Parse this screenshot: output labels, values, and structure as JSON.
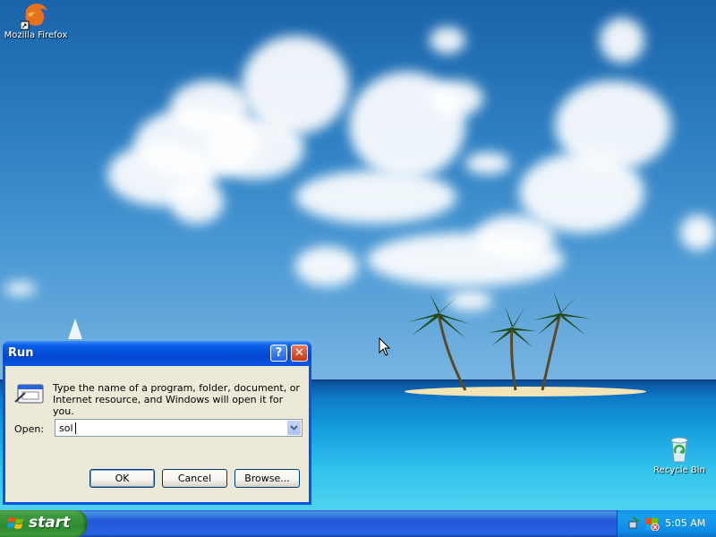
{
  "desktop": {
    "icons": [
      {
        "label": "Mozilla Firefox"
      },
      {
        "label": "Recycle Bin"
      }
    ]
  },
  "run_dialog": {
    "title": "Run",
    "help_glyph": "?",
    "close_glyph": "✕",
    "description": "Type the name of a program, folder, document, or Internet resource, and Windows will open it for you.",
    "open_label": "Open:",
    "open_value": "sol",
    "buttons": {
      "ok": "OK",
      "cancel": "Cancel",
      "browse": "Browse..."
    }
  },
  "taskbar": {
    "start_label": "start",
    "clock": "5:05 AM"
  },
  "colors": {
    "title_bar": "#0a5ee8",
    "taskbar": "#2157d7",
    "start_button": "#3c9a3c",
    "dialog_body": "#ece9d8"
  }
}
